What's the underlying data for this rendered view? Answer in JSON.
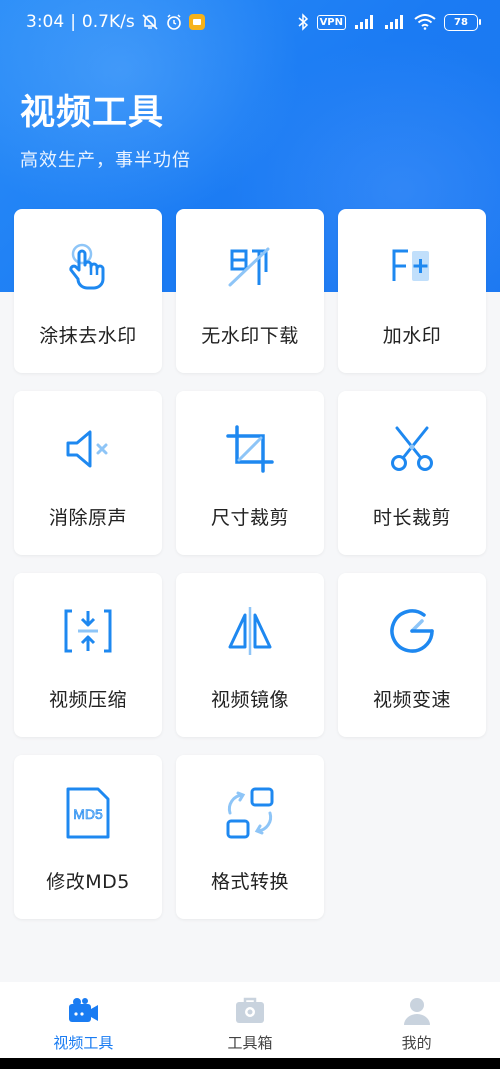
{
  "status_bar": {
    "time": "3:04",
    "network_speed": "0.7K/s",
    "vpn": "VPN",
    "battery": "78"
  },
  "header": {
    "title": "视频工具",
    "subtitle": "高效生产，事半功倍"
  },
  "colors": {
    "accent": "#1a7cf2",
    "icon_blue": "#1e88f0",
    "icon_light": "#8ec5f7",
    "hero": "#1b7bf3"
  },
  "tools": [
    {
      "label": "涂抹去水印",
      "icon": "tap-hand-icon"
    },
    {
      "label": "无水印下载",
      "icon": "no-watermark-icon"
    },
    {
      "label": "加水印",
      "icon": "add-watermark-icon"
    },
    {
      "label": "消除原声",
      "icon": "mute-speaker-icon"
    },
    {
      "label": "尺寸裁剪",
      "icon": "crop-icon"
    },
    {
      "label": "时长裁剪",
      "icon": "scissors-icon"
    },
    {
      "label": "视频压缩",
      "icon": "compress-icon"
    },
    {
      "label": "视频镜像",
      "icon": "mirror-icon"
    },
    {
      "label": "视频变速",
      "icon": "speed-gauge-icon"
    },
    {
      "label": "修改MD5",
      "icon": "md5-file-icon",
      "icon_text": "MD5"
    },
    {
      "label": "格式转换",
      "icon": "format-convert-icon"
    }
  ],
  "bottom_nav": {
    "items": [
      {
        "label": "视频工具",
        "icon": "camera-icon",
        "active": true
      },
      {
        "label": "工具箱",
        "icon": "toolbox-icon",
        "active": false
      },
      {
        "label": "我的",
        "icon": "person-icon",
        "active": false
      }
    ]
  }
}
